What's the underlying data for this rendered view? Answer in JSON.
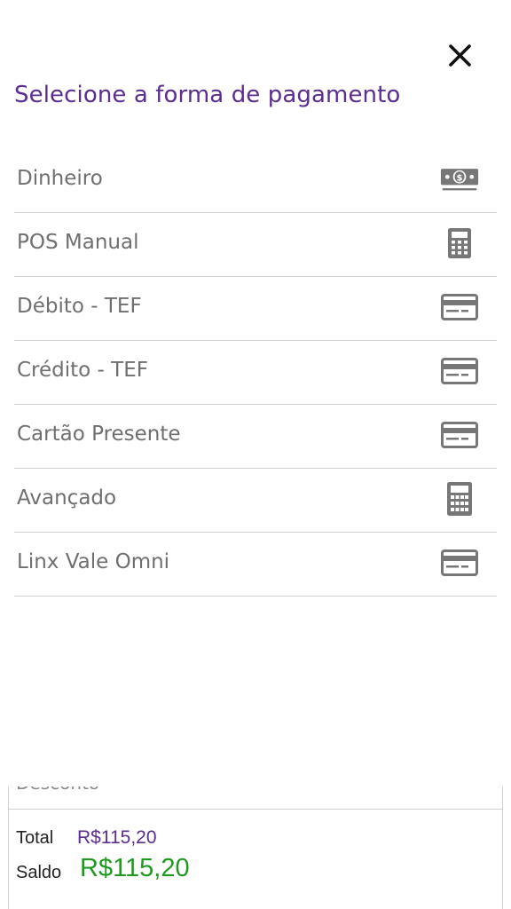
{
  "dialog": {
    "title": "Selecione a forma de pagamento",
    "close_icon": "close-icon"
  },
  "payment_methods": [
    {
      "label": "Dinheiro",
      "icon": "cash-icon"
    },
    {
      "label": "POS Manual",
      "icon": "calculator-icon"
    },
    {
      "label": "Débito - TEF",
      "icon": "credit-card-icon"
    },
    {
      "label": "Crédito - TEF",
      "icon": "credit-card-icon"
    },
    {
      "label": "Cartão Presente",
      "icon": "credit-card-icon"
    },
    {
      "label": "Avançado",
      "icon": "calculator-icon"
    },
    {
      "label": "Linx Vale Omni",
      "icon": "credit-card-icon"
    }
  ],
  "summary": {
    "cut_off_label": "Desconto",
    "total_label": "Total",
    "total_value": "R$115,20",
    "saldo_label": "Saldo",
    "saldo_value": "R$115,20"
  },
  "colors": {
    "title": "#5b2d90",
    "total_value": "#5b2d90",
    "saldo_value": "#1f9a1f",
    "item_text": "#6f6f6f",
    "icon": "#777777",
    "divider": "#cfcfcf"
  }
}
